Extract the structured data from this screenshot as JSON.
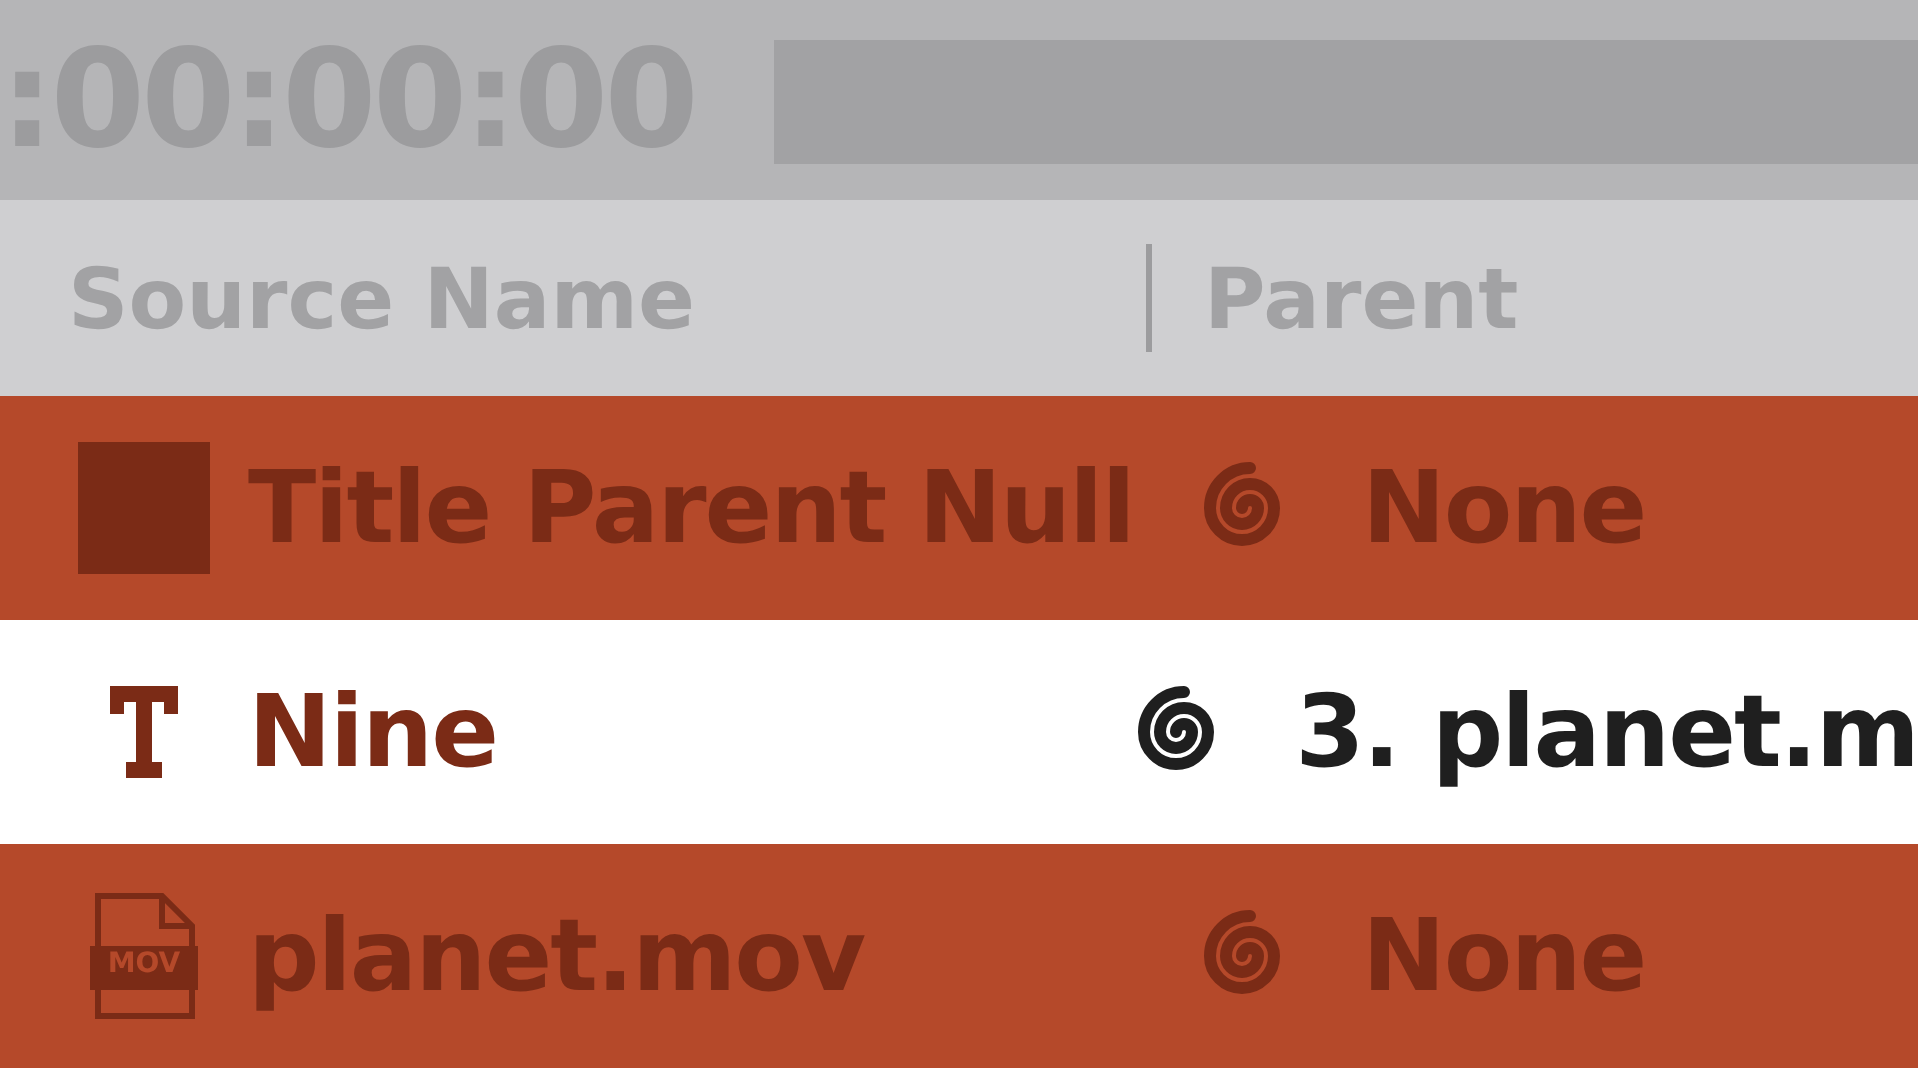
{
  "timecode": ":00:00:00",
  "columns": [
    {
      "label": "Source Name"
    },
    {
      "label": "Parent"
    }
  ],
  "rows": [
    {
      "icon": {
        "kind": "solid"
      },
      "name": "Title Parent Null",
      "parent": "None",
      "selected": true
    },
    {
      "icon": {
        "kind": "text"
      },
      "name": "Nine",
      "parent": "3. planet.m",
      "selected": false
    },
    {
      "icon": {
        "kind": "footage",
        "label": "MOV"
      },
      "name": "planet.mov",
      "parent": "None",
      "selected": true
    }
  ]
}
